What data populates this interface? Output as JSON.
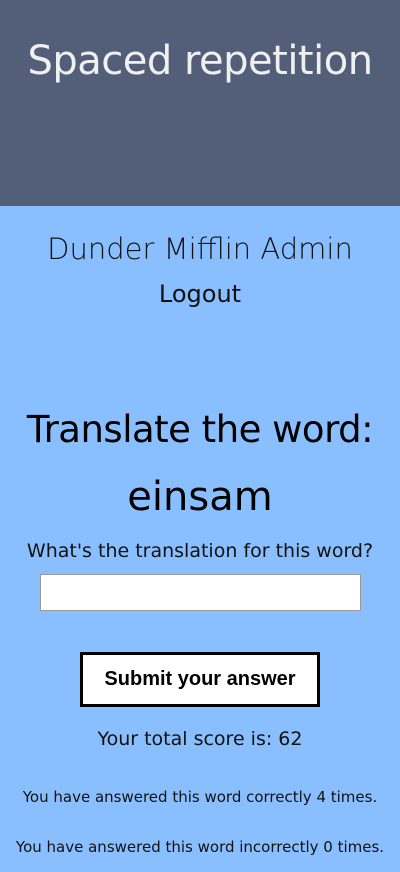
{
  "header": {
    "title": "Spaced repetition"
  },
  "user": {
    "name": "Dunder Mifflin Admin",
    "logout_label": "Logout"
  },
  "learn": {
    "title": "Translate the word:",
    "word": "einsam",
    "question": "What's the translation for this word?",
    "input_value": "",
    "input_placeholder": "",
    "submit_label": "Submit your answer",
    "score_text": "Your total score is: 62",
    "correct_text": "You have answered this word correctly 4 times.",
    "incorrect_text": "You have answered this word incorrectly 0 times."
  },
  "colors": {
    "header_bg": "#535e78",
    "page_bg": "#89bfff"
  }
}
